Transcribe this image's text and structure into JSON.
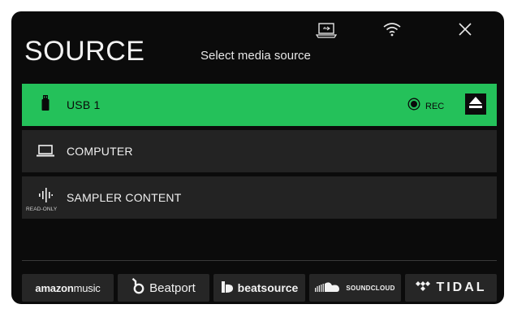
{
  "header": {
    "title": "SOURCE",
    "subtitle": "Select media source"
  },
  "sources": [
    {
      "label": "USB 1",
      "icon": "usb-drive-icon",
      "active": true,
      "rec_label": "REC"
    },
    {
      "label": "COMPUTER",
      "icon": "computer-icon",
      "active": false
    },
    {
      "label": "SAMPLER CONTENT",
      "icon": "waveform-icon",
      "active": false,
      "badge": "READ-ONLY"
    }
  ],
  "services": [
    {
      "label": "amazon",
      "label2": "music",
      "icon": "amazon-music-logo"
    },
    {
      "label": "Beatport",
      "icon": "beatport-logo-icon"
    },
    {
      "label": "beatsource",
      "icon": "beatsource-logo-icon"
    },
    {
      "label": "SOUNDCLOUD",
      "icon": "soundcloud-logo-icon"
    },
    {
      "label": "TIDAL",
      "icon": "tidal-logo-icon"
    }
  ],
  "colors": {
    "accent": "#24c15a",
    "background": "#0b0b0b",
    "row": "#232323"
  }
}
